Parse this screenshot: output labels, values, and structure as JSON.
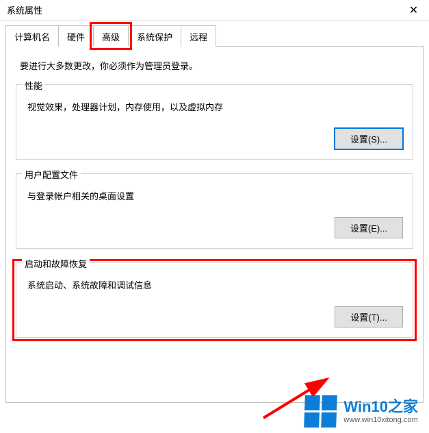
{
  "window": {
    "title": "系统属性"
  },
  "tabs": {
    "items": [
      {
        "label": "计算机名"
      },
      {
        "label": "硬件"
      },
      {
        "label": "高级"
      },
      {
        "label": "系统保护"
      },
      {
        "label": "远程"
      }
    ],
    "active_index": 2
  },
  "intro": "要进行大多数更改，你必须作为管理员登录。",
  "groups": {
    "performance": {
      "title": "性能",
      "desc": "视觉效果，处理器计划，内存使用，以及虚拟内存",
      "button": "设置(S)..."
    },
    "userprofile": {
      "title": "用户配置文件",
      "desc": "与登录帐户相关的桌面设置",
      "button": "设置(E)..."
    },
    "startup": {
      "title": "启动和故障恢复",
      "desc": "系统启动、系统故障和调试信息",
      "button": "设置(T)..."
    }
  },
  "watermark": {
    "main": "Win10之家",
    "sub": "www.win10xitong.com"
  },
  "colors": {
    "highlight": "#ff0000",
    "accent": "#0078d7"
  }
}
